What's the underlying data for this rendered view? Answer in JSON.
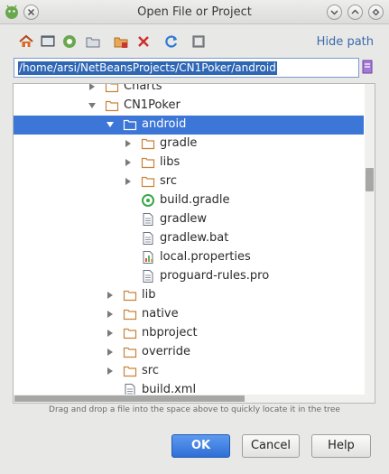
{
  "window": {
    "title": "Open File or Project",
    "app_icon": "netbeans-android-icon",
    "controls": [
      "close",
      "minimize",
      "maximize",
      "restore"
    ]
  },
  "toolbar": {
    "icons": [
      "home-icon",
      "desktop-icon",
      "android-project-icon",
      "new-folder-icon",
      "module-icon",
      "delete-icon",
      "refresh-icon",
      "show-hidden-icon"
    ],
    "hide_path_label": "Hide path"
  },
  "path": {
    "value": "/home/arsi/NetBeansProjects/CN1Poker/android"
  },
  "tree": {
    "rows": [
      {
        "label": "Charts",
        "type": "folder",
        "expanded": false,
        "depth": 0
      },
      {
        "label": "CN1Poker",
        "type": "folder",
        "expanded": true,
        "depth": 0
      },
      {
        "label": "android",
        "type": "folder",
        "expanded": true,
        "depth": 1,
        "selected": true
      },
      {
        "label": "gradle",
        "type": "folder",
        "expanded": false,
        "depth": 2
      },
      {
        "label": "libs",
        "type": "folder",
        "expanded": false,
        "depth": 2
      },
      {
        "label": "src",
        "type": "folder",
        "expanded": false,
        "depth": 2
      },
      {
        "label": "build.gradle",
        "type": "gradle",
        "depth": 2
      },
      {
        "label": "gradlew",
        "type": "file",
        "depth": 2
      },
      {
        "label": "gradlew.bat",
        "type": "file",
        "depth": 2
      },
      {
        "label": "local.properties",
        "type": "properties",
        "depth": 2
      },
      {
        "label": "proguard-rules.pro",
        "type": "file",
        "depth": 2
      },
      {
        "label": "lib",
        "type": "folder",
        "expanded": false,
        "depth": 1
      },
      {
        "label": "native",
        "type": "folder",
        "expanded": false,
        "depth": 1
      },
      {
        "label": "nbproject",
        "type": "folder",
        "expanded": false,
        "depth": 1
      },
      {
        "label": "override",
        "type": "folder",
        "expanded": false,
        "depth": 1
      },
      {
        "label": "src",
        "type": "folder",
        "expanded": false,
        "depth": 1
      },
      {
        "label": "build.xml",
        "type": "file",
        "depth": 1
      }
    ]
  },
  "hint": "Drag and drop a file into the space above to quickly locate it in the tree",
  "buttons": {
    "ok": "OK",
    "cancel": "Cancel",
    "help": "Help"
  },
  "colors": {
    "selection": "#3c76d6",
    "folder": "#c8833a",
    "link": "#3b6aab",
    "primary_button": "#2f6fd5"
  }
}
